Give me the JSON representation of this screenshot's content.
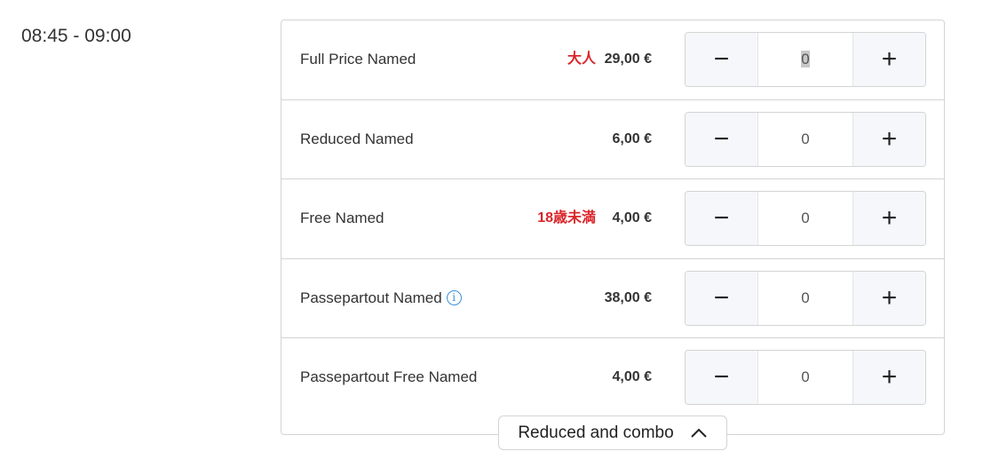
{
  "time_slot": "08:45 - 09:00",
  "tickets": [
    {
      "name": "Full Price Named",
      "tag": "大人",
      "price": "29,00 €",
      "quantity": "0",
      "info": false
    },
    {
      "name": "Reduced Named",
      "tag": "",
      "price": "6,00 €",
      "quantity": "0",
      "info": false
    },
    {
      "name": "Free Named",
      "tag": "18歳未満",
      "price": "4,00 €",
      "quantity": "0",
      "info": false
    },
    {
      "name": "Passepartout Named",
      "tag": "",
      "price": "38,00 €",
      "quantity": "0",
      "info": true
    },
    {
      "name": "Passepartout Free Named",
      "tag": "",
      "price": "4,00 €",
      "quantity": "0",
      "info": false
    }
  ],
  "icons": {
    "minus": "−",
    "plus": "+",
    "info": "i",
    "chevron": "chevron-up-icon"
  },
  "toggle_label": "Reduced and combo",
  "colors": {
    "tag": "#d9252a",
    "info": "#3a8fd6"
  }
}
